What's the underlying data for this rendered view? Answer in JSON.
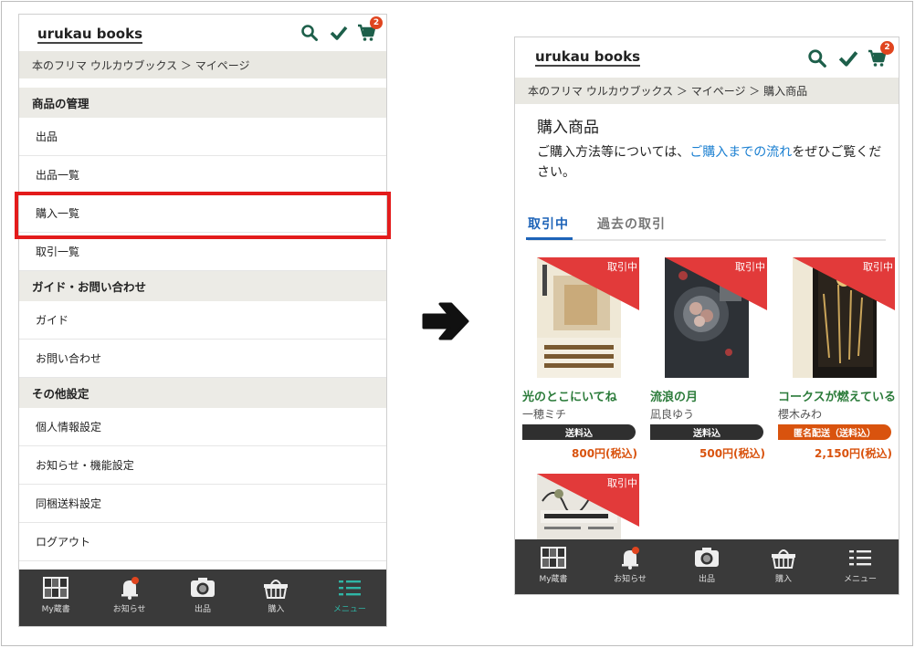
{
  "brand": {
    "logo_text": "urukau books",
    "accent": "#2fb6a6",
    "highlight": "#e31b1b"
  },
  "header_icons": [
    "search-icon",
    "check-icon",
    "cart-icon"
  ],
  "left": {
    "cart_count": "2",
    "breadcrumb": "本のフリマ ウルカウブックス ＞ マイページ",
    "sections": [
      {
        "title": "商品の管理",
        "items": [
          "出品",
          "出品一覧",
          "購入一覧",
          "取引一覧"
        ]
      },
      {
        "title": "ガイド・お問い合わせ",
        "items": [
          "ガイド",
          "お問い合わせ"
        ]
      },
      {
        "title": "その他設定",
        "items": [
          "個人情報設定",
          "お知らせ・機能設定",
          "同梱送料設定",
          "ログアウト"
        ]
      }
    ],
    "highlighted_item": "購入一覧",
    "nav": [
      "My蔵書",
      "お知らせ",
      "出品",
      "購入",
      "メニュー"
    ],
    "nav_active": "メニュー"
  },
  "right": {
    "cart_count": "2",
    "breadcrumb": "本のフリマ ウルカウブックス ＞ マイページ ＞ 購入商品",
    "page_title": "購入商品",
    "desc_before": "ご購入方法等については、",
    "desc_link": "ご購入までの流れ",
    "desc_after": "をぜひご覧ください。",
    "tabs": {
      "active": "取引中",
      "inactive": "過去の取引"
    },
    "ribbon_label": "取引中",
    "books": [
      {
        "title": "光のとこにいてね",
        "author": "一穂ミチ",
        "shipping": "送料込",
        "price": "800円(税込)"
      },
      {
        "title": "流浪の月",
        "author": "凪良ゆう",
        "shipping": "送料込",
        "price": "500円(税込)"
      },
      {
        "title": "コークスが燃えている",
        "author": "櫻木みわ",
        "shipping": "匿名配送（送料込）",
        "price": "2,150円(税込)"
      },
      {
        "title": "",
        "author": "",
        "shipping": "",
        "price": ""
      }
    ],
    "nav": [
      "My蔵書",
      "お知らせ",
      "出品",
      "購入",
      "メニュー"
    ]
  }
}
